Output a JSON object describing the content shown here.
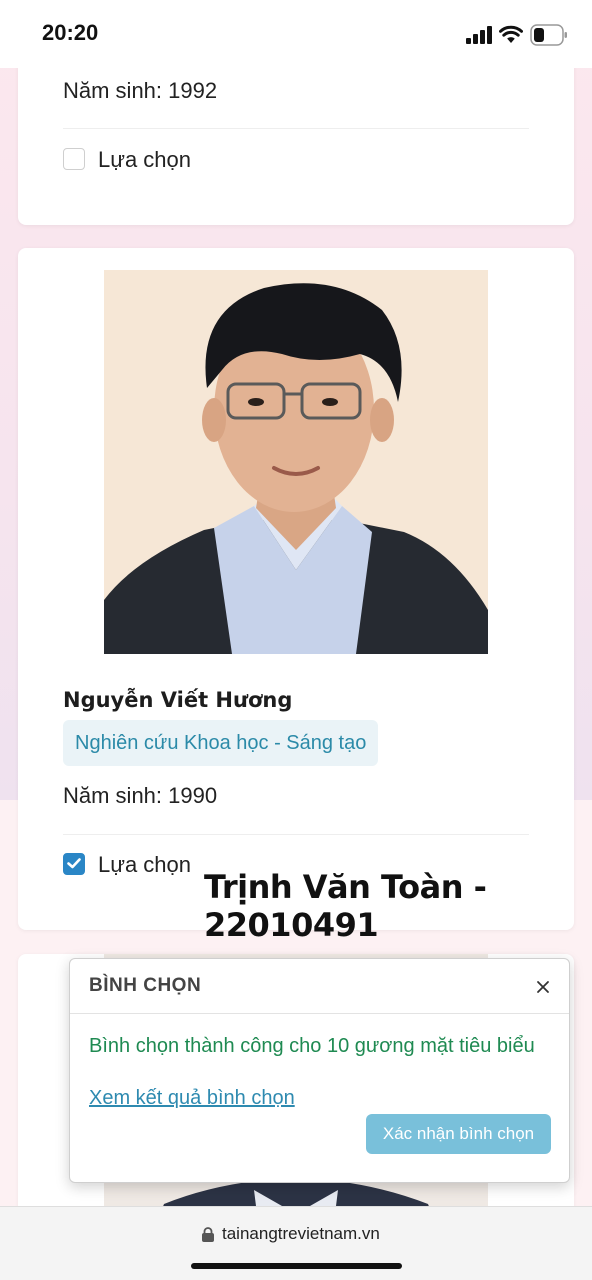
{
  "status_bar": {
    "time": "20:20"
  },
  "cards": [
    {
      "birth_year": "Năm sinh: 1992",
      "checkbox_label": "Lựa chọn",
      "checked": false
    },
    {
      "name": "Nguyễn Viết Hương",
      "category": "Nghiên cứu Khoa học - Sáng tạo",
      "birth_year": "Năm sinh: 1990",
      "checkbox_label": "Lựa chọn",
      "checked": true,
      "overlay_text": "Trịnh Văn Toàn - 22010491"
    }
  ],
  "modal": {
    "title": "BÌNH CHỌN",
    "message": "Bình chọn thành công cho 10 gương mặt tiêu biểu",
    "result_link": "Xem kết quả bình chọn",
    "confirm_label": "Xác nhận bình chọn"
  },
  "browser": {
    "url": "tainangtrevietnam.vn"
  },
  "colors": {
    "accent_blue": "#2a86c6",
    "success_green": "#1f8a52",
    "link_blue": "#2e8ab0",
    "button_blue": "#79c0da",
    "tag_bg": "#eaf3f7"
  }
}
